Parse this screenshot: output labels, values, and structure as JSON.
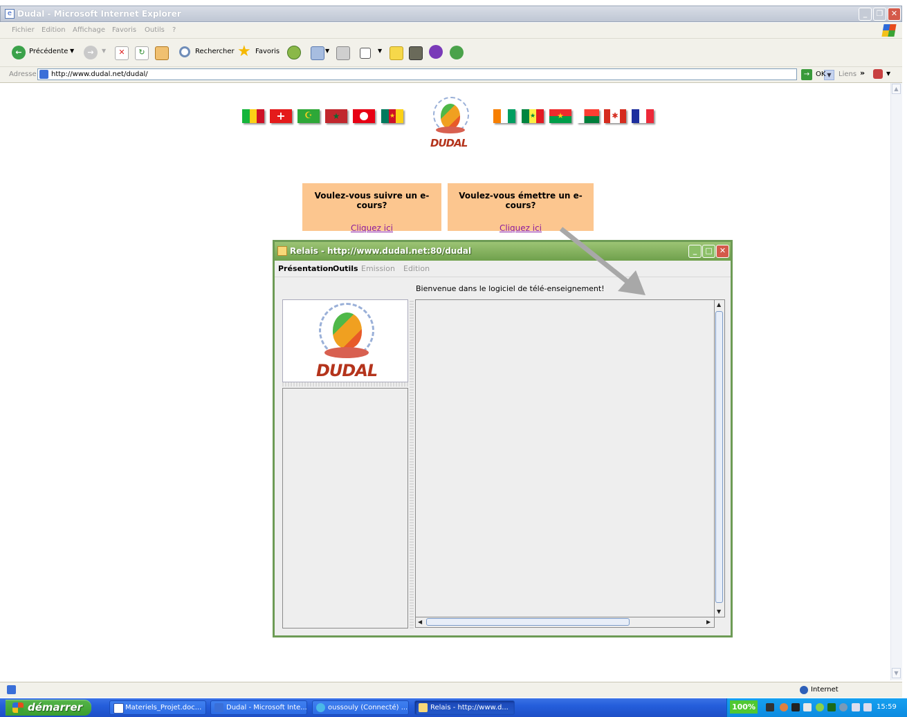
{
  "ie": {
    "window_title": "Dudal - Microsoft Internet Explorer",
    "menu": [
      "Fichier",
      "Edition",
      "Affichage",
      "Favoris",
      "Outils",
      "?"
    ],
    "toolbar": {
      "back": "Précédente",
      "search": "Rechercher",
      "favorites": "Favoris"
    },
    "address": {
      "label": "Adresse",
      "url": "http://www.dudal.net/dudal/",
      "go": "OK",
      "links": "Liens"
    },
    "status_zone": "Internet"
  },
  "page": {
    "logo_text": "DUDAL",
    "panels": [
      {
        "question": "Voulez-vous suivre un e-cours?",
        "link": "Cliquez ici"
      },
      {
        "question": "Voulez-vous émettre un e-cours?",
        "link": "Cliquez ici"
      }
    ]
  },
  "java_window": {
    "title": "Relais - http://www.dudal.net:80/dudal",
    "menu": [
      {
        "label": "Présentation",
        "enabled": true
      },
      {
        "label": "Outils",
        "enabled": true
      },
      {
        "label": "Emission",
        "enabled": false
      },
      {
        "label": "Edition",
        "enabled": false
      }
    ],
    "welcome": "Bienvenue dans le logiciel de télé-enseignement!",
    "logo_text": "DUDAL"
  },
  "taskbar": {
    "start": "démarrer",
    "tasks": [
      "Materiels_Projet.doc...",
      "Dudal - Microsoft Inte...",
      "oussouly (Connecté) ...",
      "Relais - http://www.d..."
    ],
    "battery": "100%",
    "clock": "15:59"
  },
  "colors": {
    "panel": "#fcc68f",
    "link": "#8b1a9e",
    "java_frame": "#6d9b55"
  }
}
